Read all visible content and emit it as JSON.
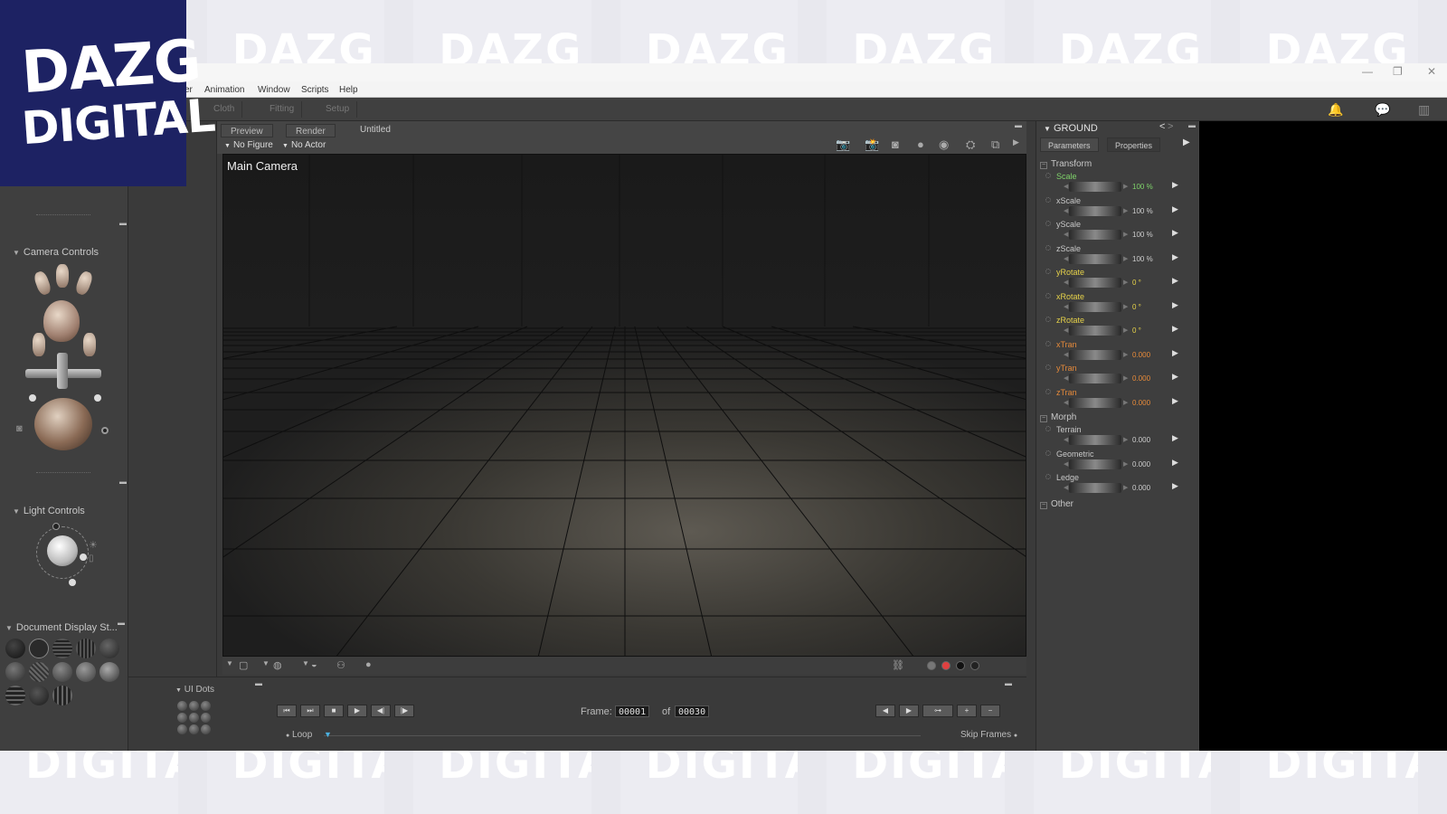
{
  "watermark": {
    "text": "DAZG DIGITAL"
  },
  "logo": {
    "line1": "DAZG",
    "line2": "DIGITAL"
  },
  "window": {
    "minimize": "—",
    "maximize": "❐",
    "close": "✕"
  },
  "menu": {
    "items": [
      "er",
      "Animation",
      "Window",
      "Scripts",
      "Help"
    ]
  },
  "rooms": {
    "tabs": [
      "Cloth",
      "Fitting",
      "Setup"
    ]
  },
  "left_panel": {
    "camera_controls_title": "Camera Controls",
    "light_controls_title": "Light Controls",
    "document_display_title": "Document Display St..."
  },
  "document": {
    "tabs": [
      "Preview",
      "Render"
    ],
    "title": "Untitled",
    "figure_selector": "No Figure",
    "actor_selector": "No Actor",
    "camera_label": "Main Camera"
  },
  "parameters": {
    "actor": "GROUND",
    "tabs": [
      "Parameters",
      "Properties"
    ],
    "groups": {
      "transform": "Transform",
      "morph": "Morph",
      "other": "Other"
    },
    "transform": [
      {
        "label": "Scale",
        "value": "100 %",
        "color": "#7fd36a",
        "value_color": "#7fd36a"
      },
      {
        "label": "xScale",
        "value": "100 %",
        "color": "#c8c8c8",
        "value_color": "#cccccc"
      },
      {
        "label": "yScale",
        "value": "100 %",
        "color": "#c8c8c8",
        "value_color": "#cccccc"
      },
      {
        "label": "zScale",
        "value": "100 %",
        "color": "#c8c8c8",
        "value_color": "#cccccc"
      },
      {
        "label": "yRotate",
        "value": "0 °",
        "color": "#e6d24a",
        "value_color": "#e6d24a"
      },
      {
        "label": "xRotate",
        "value": "0 °",
        "color": "#e6d24a",
        "value_color": "#e6d24a"
      },
      {
        "label": "zRotate",
        "value": "0 °",
        "color": "#e6d24a",
        "value_color": "#e6d24a"
      },
      {
        "label": "xTran",
        "value": "0.000",
        "color": "#e68a3a",
        "value_color": "#e68a3a"
      },
      {
        "label": "yTran",
        "value": "0.000",
        "color": "#e68a3a",
        "value_color": "#e68a3a"
      },
      {
        "label": "zTran",
        "value": "0.000",
        "color": "#e68a3a",
        "value_color": "#e68a3a"
      }
    ],
    "morph": [
      {
        "label": "Terrain",
        "value": "0.000",
        "color": "#c8c8c8",
        "value_color": "#cccccc"
      },
      {
        "label": "Geometric",
        "value": "0.000",
        "color": "#c8c8c8",
        "value_color": "#cccccc"
      },
      {
        "label": "Ledge",
        "value": "0.000",
        "color": "#c8c8c8",
        "value_color": "#cccccc"
      }
    ]
  },
  "timeline": {
    "ui_dots_title": "UI Dots",
    "frame_label": "Frame",
    "current_frame": "00001",
    "of_label": "of",
    "total_frames": "00030",
    "loop_label": "Loop",
    "skip_frames_label": "Skip Frames",
    "transport": [
      "⏮",
      "⏭",
      "■",
      "▶",
      "◀|",
      "|▶"
    ],
    "key_buttons": [
      "◀",
      "▶",
      "🔑",
      "+",
      "−"
    ]
  },
  "viewport_bottom": {
    "swatch_colors": [
      "#777777",
      "#e04040",
      "#111111",
      "#222222"
    ]
  }
}
